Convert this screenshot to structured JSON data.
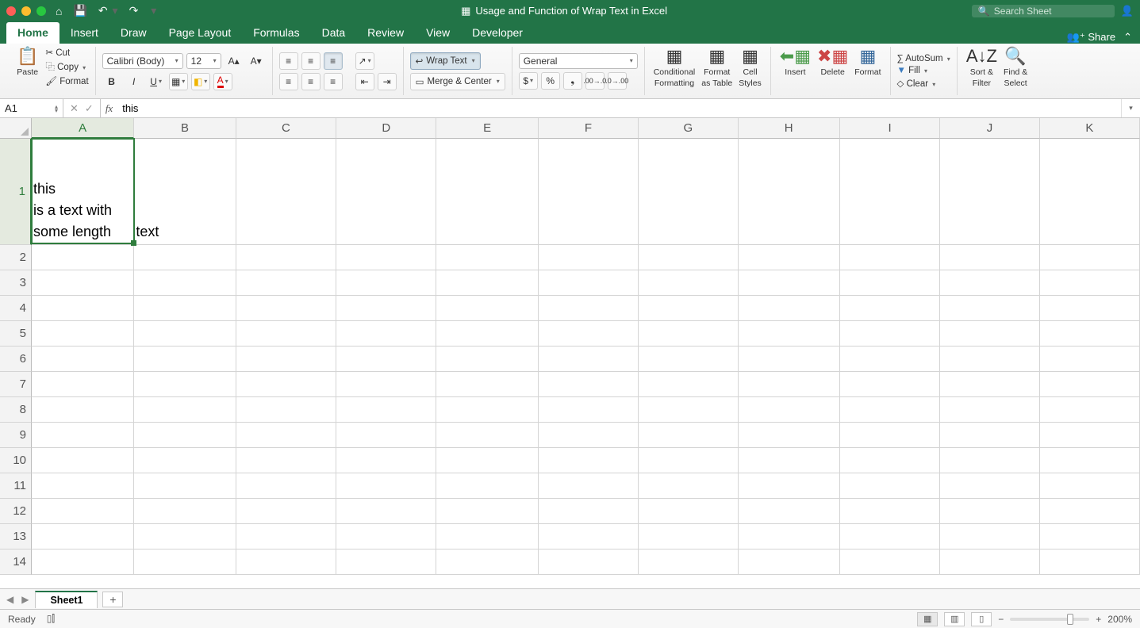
{
  "title": "Usage and Function of Wrap Text in Excel",
  "search_placeholder": "Search Sheet",
  "tabs": [
    "Home",
    "Insert",
    "Draw",
    "Page Layout",
    "Formulas",
    "Data",
    "Review",
    "View",
    "Developer"
  ],
  "share": "Share",
  "clipboard": {
    "paste": "Paste",
    "cut": "Cut",
    "copy": "Copy",
    "format": "Format"
  },
  "font": {
    "name": "Calibri (Body)",
    "size": "12"
  },
  "wrap_text": "Wrap Text",
  "merge_center": "Merge & Center",
  "number_format": "General",
  "big_buttons": {
    "cond": "Conditional",
    "cond2": "Formatting",
    "fmt": "Format",
    "fmt2": "as Table",
    "styles": "Cell",
    "styles2": "Styles",
    "insert": "Insert",
    "delete": "Delete",
    "format": "Format"
  },
  "editing": {
    "autosum": "AutoSum",
    "fill": "Fill",
    "clear": "Clear",
    "sort": "Sort &",
    "sort2": "Filter",
    "find": "Find &",
    "find2": "Select"
  },
  "namebox": "A1",
  "formula": "this",
  "columns": [
    "A",
    "B",
    "C",
    "D",
    "E",
    "F",
    "G",
    "H",
    "I",
    "J",
    "K"
  ],
  "rows": [
    "1",
    "2",
    "3",
    "4",
    "5",
    "6",
    "7",
    "8",
    "9",
    "10",
    "11",
    "12",
    "13",
    "14"
  ],
  "cell_a1_l1": "this",
  "cell_a1_l2": "is a text with",
  "cell_a1_l3": "some length",
  "cell_b1": "text",
  "sheet_name": "Sheet1",
  "status": "Ready",
  "zoom": "200%"
}
